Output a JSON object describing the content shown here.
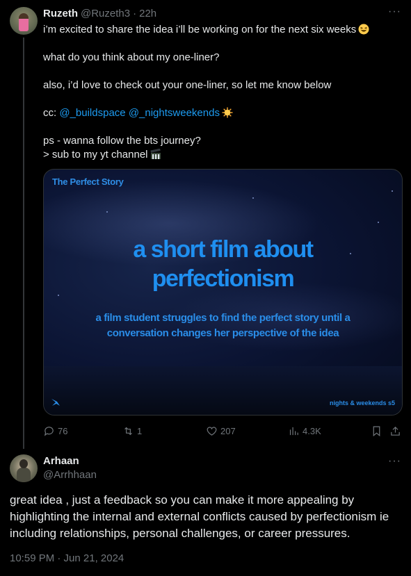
{
  "tweet": {
    "name": "Ruzeth",
    "handle": "@Ruzeth3",
    "separator": "·",
    "time": "22h",
    "more": "···",
    "line1": "i’m excited to share the idea i’ll be working on for the next six weeks",
    "line2": "what do you think about my one-liner?",
    "line3": "also, i’d love to check out your one-liner, so let me know below",
    "cc_prefix": "cc: ",
    "mention1": "@_buildspace",
    "mention2": "@_nightsweekends",
    "line5a": "ps - wanna follow the bts journey?",
    "line5b": "> sub to my yt channel",
    "card": {
      "brand": "The Perfect Story",
      "title_line1": "a short film about",
      "title_line2": "perfectionism",
      "sub_line1": "a film student struggles to find the perfect story until a",
      "sub_line2": "conversation changes her perspective of the idea",
      "footer": "nights & weekends s5"
    },
    "actions": {
      "replies": "76",
      "reposts": "1",
      "likes": "207",
      "views": "4.3K"
    }
  },
  "reply": {
    "name": "Arhaan",
    "handle": "@Arrhhaan",
    "more": "···",
    "text": "great idea , just a feedback so you can make it more appealing by highlighting the internal and external conflicts caused by perfectionism ie including relationships, personal challenges, or career pressures.",
    "timestamp": "10:59 PM · Jun 21, 2024"
  },
  "colors": {
    "background": "#000000",
    "text": "#e7e9ea",
    "muted": "#71767b",
    "link": "#1d9bf0",
    "card_accent": "#1f8ff0"
  },
  "icons": [
    "laughing-emoji-icon",
    "sun-emoji-icon",
    "clapper-emoji-icon",
    "reply-icon",
    "repost-icon",
    "like-icon",
    "views-icon",
    "bookmark-icon",
    "share-icon",
    "buildspace-logo-icon"
  ]
}
